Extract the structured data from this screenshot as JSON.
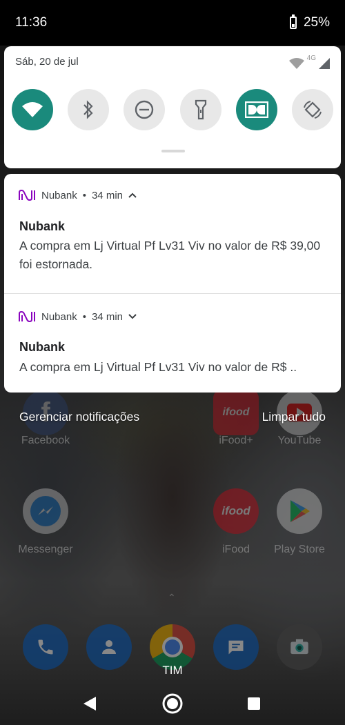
{
  "status_bar": {
    "time": "11:36",
    "battery": "25%"
  },
  "quick_settings": {
    "date": "Sáb, 20 de jul",
    "network_type": "4G",
    "tiles": [
      {
        "name": "wifi",
        "icon": "wifi-icon",
        "on": true
      },
      {
        "name": "bluetooth",
        "icon": "bluetooth-icon",
        "on": false
      },
      {
        "name": "do-not-disturb",
        "icon": "do-not-disturb-icon",
        "on": false
      },
      {
        "name": "flashlight",
        "icon": "flashlight-icon",
        "on": false
      },
      {
        "name": "dolby",
        "icon": "dolby-icon",
        "on": true
      },
      {
        "name": "auto-rotate",
        "icon": "auto-rotate-icon",
        "on": false
      }
    ],
    "accent_color": "#1a8a7c"
  },
  "notifications": [
    {
      "app": "Nubank",
      "time": "34 min",
      "expanded": true,
      "title": "Nubank",
      "body": "A compra em Lj Virtual Pf Lv31 Viv no valor de R$ 39,00 foi estornada."
    },
    {
      "app": "Nubank",
      "time": "34 min",
      "expanded": false,
      "title": "Nubank",
      "body": "A compra em Lj Virtual Pf Lv31 Viv no valor de R$ .."
    }
  ],
  "nubank_color": "#8a05be",
  "actions": {
    "manage": "Gerenciar notificações",
    "clear_all": "Limpar tudo"
  },
  "home_apps": {
    "row1": [
      "Facebook",
      "iFood+",
      "YouTube"
    ],
    "row2": [
      "Messenger",
      "iFood",
      "Play Store"
    ]
  },
  "carrier": "TIM",
  "separator": "•"
}
